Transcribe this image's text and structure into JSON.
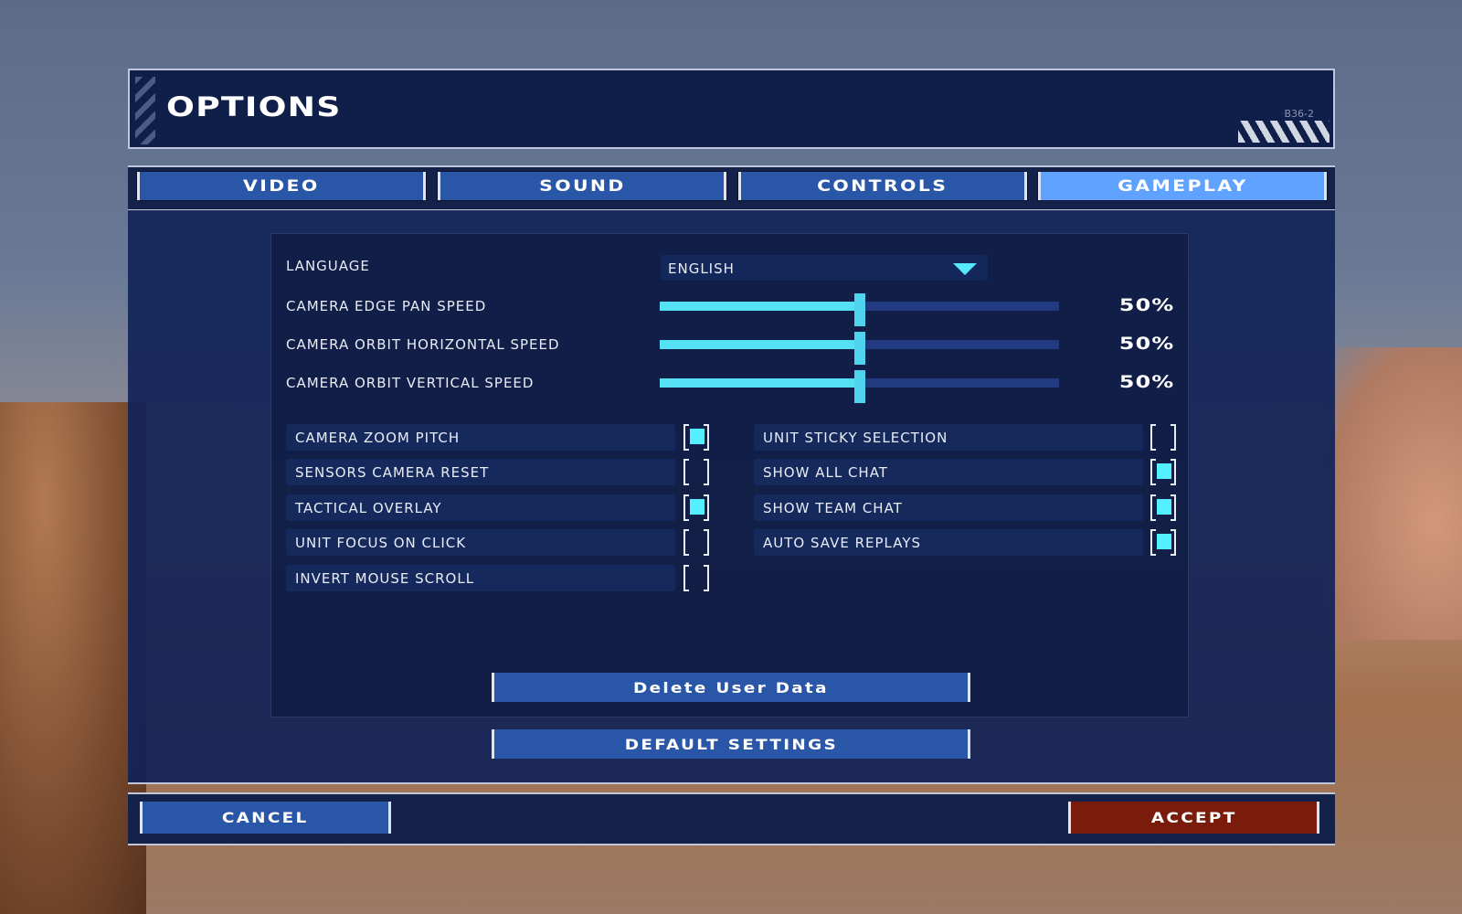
{
  "header": {
    "title": "OPTIONS",
    "code": "B36-2"
  },
  "tabs": [
    {
      "label": "VIDEO",
      "active": false
    },
    {
      "label": "SOUND",
      "active": false
    },
    {
      "label": "CONTROLS",
      "active": false
    },
    {
      "label": "GAMEPLAY",
      "active": true
    }
  ],
  "language": {
    "label": "LANGUAGE",
    "value": "ENGLISH"
  },
  "sliders": [
    {
      "label": "CAMERA EDGE PAN SPEED",
      "value": 50,
      "display": "50%"
    },
    {
      "label": "CAMERA ORBIT HORIZONTAL SPEED",
      "value": 50,
      "display": "50%"
    },
    {
      "label": "CAMERA ORBIT VERTICAL SPEED",
      "value": 50,
      "display": "50%"
    }
  ],
  "left_toggles": [
    {
      "label": "CAMERA ZOOM PITCH",
      "checked": true
    },
    {
      "label": "SENSORS CAMERA RESET",
      "checked": false
    },
    {
      "label": "TACTICAL OVERLAY",
      "checked": true
    },
    {
      "label": "UNIT FOCUS ON CLICK",
      "checked": false
    },
    {
      "label": "INVERT MOUSE SCROLL",
      "checked": false
    }
  ],
  "right_toggles": [
    {
      "label": "UNIT STICKY SELECTION",
      "checked": false
    },
    {
      "label": "SHOW ALL CHAT",
      "checked": true
    },
    {
      "label": "SHOW TEAM CHAT",
      "checked": true
    },
    {
      "label": "AUTO SAVE REPLAYS",
      "checked": true
    }
  ],
  "buttons": {
    "delete": "Delete User Data",
    "defaults": "DEFAULT SETTINGS",
    "cancel": "CANCEL",
    "accept": "ACCEPT"
  },
  "colors": {
    "accent": "#55e0f4",
    "tab_active": "#5fa2ff",
    "button": "#2a56a8",
    "accept": "#7a1c0c"
  }
}
